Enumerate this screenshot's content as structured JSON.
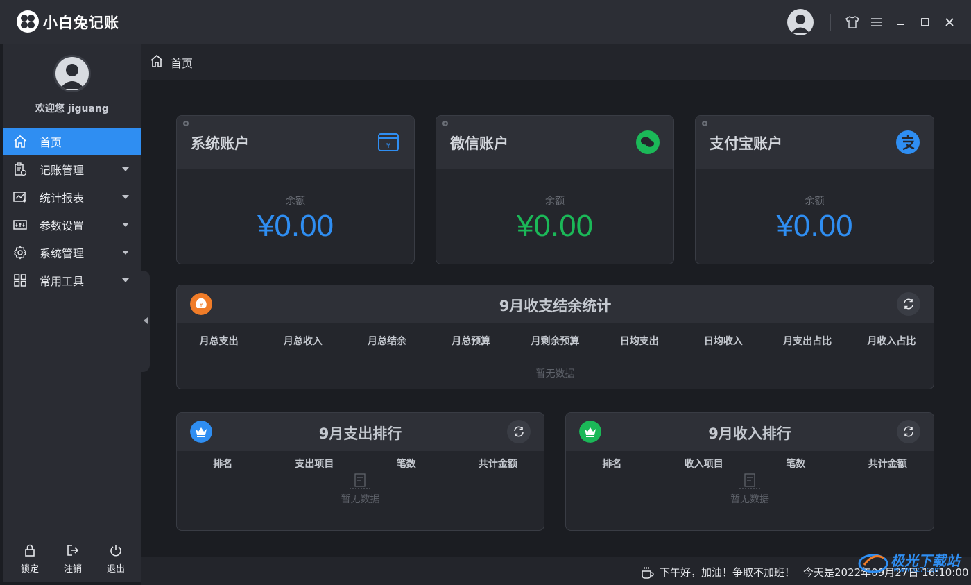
{
  "app": {
    "title": "小白兔记账"
  },
  "sidebar": {
    "welcome": "欢迎您 jiguang",
    "items": [
      {
        "label": "首页",
        "icon": "home-icon"
      },
      {
        "label": "记账管理",
        "icon": "clipboard-icon"
      },
      {
        "label": "统计报表",
        "icon": "chart-icon"
      },
      {
        "label": "参数设置",
        "icon": "settings-panel-icon"
      },
      {
        "label": "系统管理",
        "icon": "gear-icon"
      },
      {
        "label": "常用工具",
        "icon": "grid-icon"
      }
    ],
    "bottom": {
      "lock": "锁定",
      "logout": "注销",
      "exit": "退出"
    }
  },
  "breadcrumb": {
    "current": "首页"
  },
  "accounts": {
    "system": {
      "title": "系统账户",
      "label": "余额",
      "value": "¥0.00",
      "color": "#2f8ef2"
    },
    "wechat": {
      "title": "微信账户",
      "label": "余额",
      "value": "¥0.00",
      "color": "#1bb858"
    },
    "alipay": {
      "title": "支付宝账户",
      "label": "余额",
      "value": "¥0.00",
      "color": "#2f8ef2"
    }
  },
  "monthly": {
    "title": "9月收支结余统计",
    "columns": [
      "月总支出",
      "月总收入",
      "月总结余",
      "月总预算",
      "月剩余预算",
      "日均支出",
      "日均收入",
      "月支出占比",
      "月收入占比"
    ],
    "empty": "暂无数据"
  },
  "expense_rank": {
    "title": "9月支出排行",
    "columns": [
      "排名",
      "支出项目",
      "笔数",
      "共计金额"
    ],
    "empty": "暂无数据"
  },
  "income_rank": {
    "title": "9月收入排行",
    "columns": [
      "排名",
      "收入项目",
      "笔数",
      "共计金额"
    ],
    "empty": "暂无数据"
  },
  "status": {
    "greeting": "下午好，加油！争取不加班！",
    "date": "今天是2022年09月27日 16:10:00"
  },
  "watermark": {
    "text": "极光下载站",
    "sub": "www.xz7.com"
  }
}
